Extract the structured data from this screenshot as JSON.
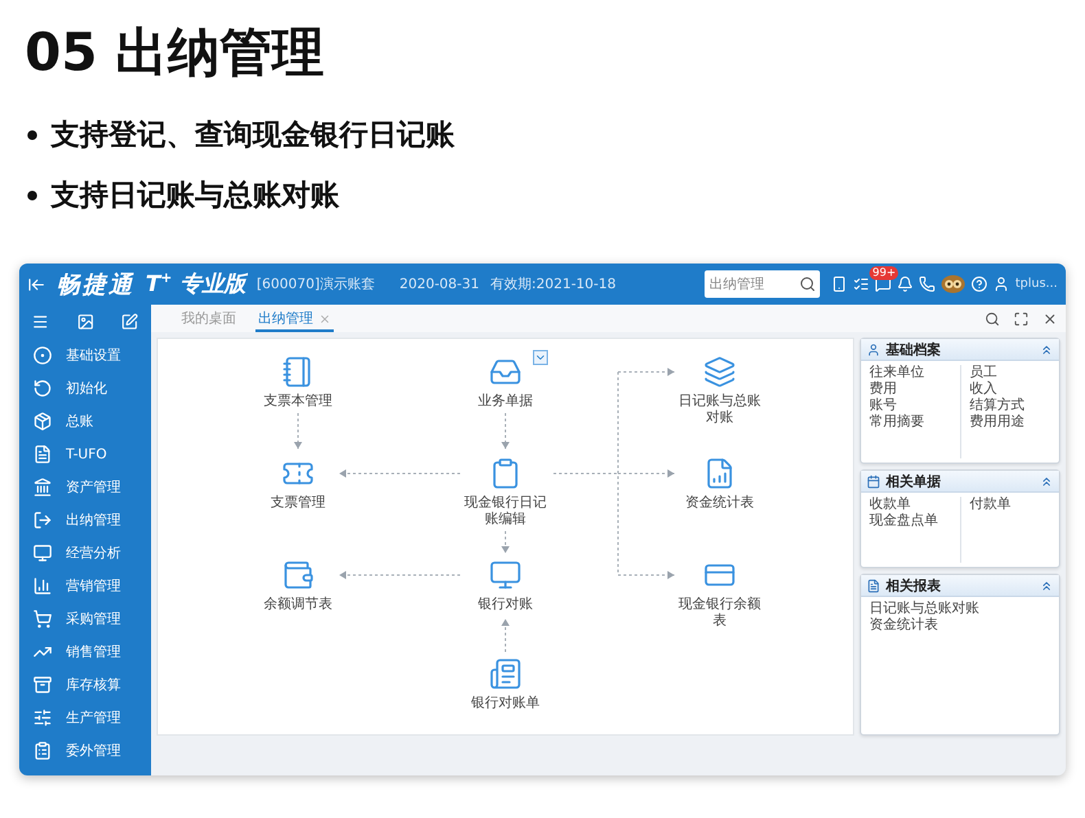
{
  "heading": "05 出纳管理",
  "bullets": [
    "支持登记、查询现金银行日记账",
    "支持日记账与总账对账"
  ],
  "app": {
    "header": {
      "brand": "畅捷通",
      "product": "T",
      "product_sup": "+",
      "edition": "专业版",
      "account": "[600070]演示账套",
      "date": "2020-08-31",
      "validity": "有效期:2021-10-18",
      "search": {
        "value": "出纳管理"
      },
      "badge": "99+",
      "user": "tplus..."
    },
    "sidebar": {
      "items": [
        {
          "label": "基础设置"
        },
        {
          "label": "初始化"
        },
        {
          "label": "总账"
        },
        {
          "label": "T-UFO"
        },
        {
          "label": "资产管理"
        },
        {
          "label": "出纳管理"
        },
        {
          "label": "经营分析"
        },
        {
          "label": "营销管理"
        },
        {
          "label": "采购管理"
        },
        {
          "label": "销售管理"
        },
        {
          "label": "库存核算"
        },
        {
          "label": "生产管理"
        },
        {
          "label": "委外管理"
        }
      ]
    },
    "tabs": [
      {
        "label": "我的桌面",
        "selected": false,
        "closable": false
      },
      {
        "label": "出纳管理",
        "selected": true,
        "closable": true
      }
    ],
    "diagram": {
      "nodes": [
        {
          "label": "支票本管理",
          "dropdown": false
        },
        {
          "label": "业务单据",
          "dropdown": true
        },
        {
          "label": "日记账与总账对账",
          "dropdown": false
        },
        {
          "label": "支票管理",
          "dropdown": false
        },
        {
          "label": "现金银行日记账编辑",
          "dropdown": false
        },
        {
          "label": "资金统计表",
          "dropdown": false
        },
        {
          "label": "余额调节表",
          "dropdown": false
        },
        {
          "label": "银行对账",
          "dropdown": false
        },
        {
          "label": "现金银行余额表",
          "dropdown": false
        },
        {
          "label": "银行对账单",
          "dropdown": false
        }
      ]
    },
    "panels": [
      {
        "title": "基础档案",
        "columns": [
          [
            "往来单位",
            "费用",
            "账号",
            "常用摘要"
          ],
          [
            "员工",
            "收入",
            "结算方式",
            "费用用途"
          ]
        ]
      },
      {
        "title": "相关单据",
        "columns": [
          [
            "收款单",
            "现金盘点单"
          ],
          [
            "付款单"
          ]
        ]
      },
      {
        "title": "相关报表",
        "columns": [
          [
            "日记账与总账对账",
            "资金统计表"
          ]
        ]
      }
    ]
  }
}
